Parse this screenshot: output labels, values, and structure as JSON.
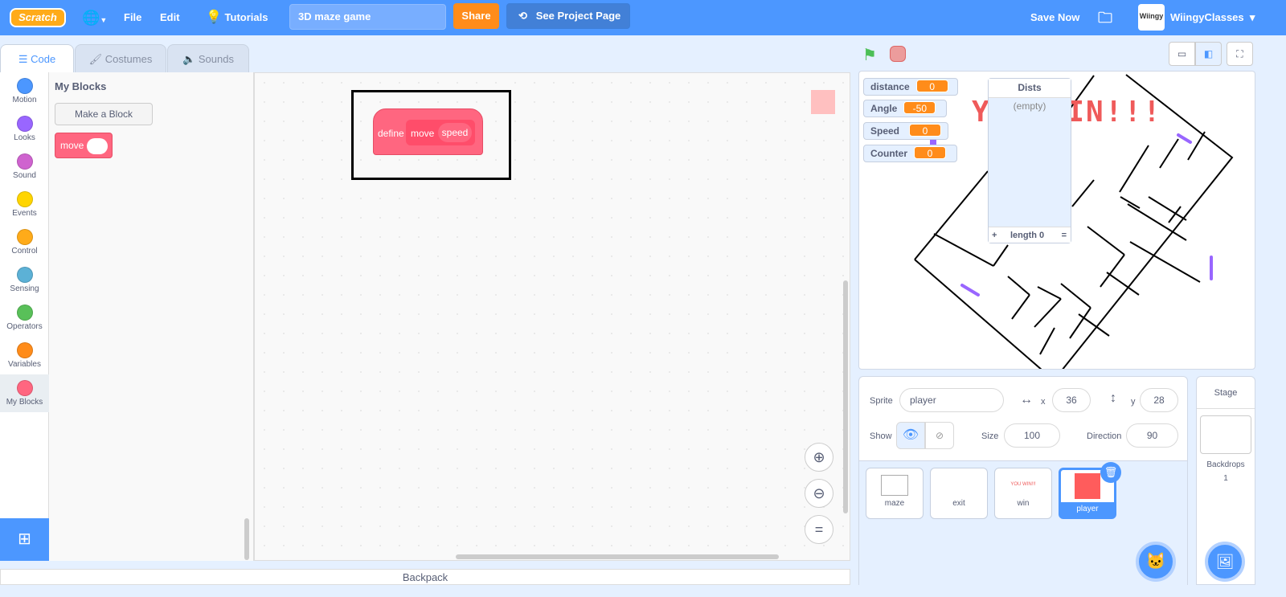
{
  "header": {
    "logo": "SCRATCH",
    "file": "File",
    "edit": "Edit",
    "tutorials": "Tutorials",
    "project_title": "3D maze game",
    "share": "Share",
    "see_project_page": "See Project Page",
    "save_now": "Save Now",
    "username": "WiingyClasses"
  },
  "tabs": [
    {
      "label": "Code"
    },
    {
      "label": "Costumes"
    },
    {
      "label": "Sounds"
    }
  ],
  "categories": [
    {
      "label": "Motion",
      "color": "#4c97ff"
    },
    {
      "label": "Looks",
      "color": "#9966ff"
    },
    {
      "label": "Sound",
      "color": "#cf63cf"
    },
    {
      "label": "Events",
      "color": "#ffd500"
    },
    {
      "label": "Control",
      "color": "#ffab19"
    },
    {
      "label": "Sensing",
      "color": "#5cb1d6"
    },
    {
      "label": "Operators",
      "color": "#59c059"
    },
    {
      "label": "Variables",
      "color": "#ff8c1a"
    },
    {
      "label": "My Blocks",
      "color": "#ff6680"
    }
  ],
  "palette": {
    "heading": "My Blocks",
    "make_block": "Make a Block",
    "block_label": "move"
  },
  "script": {
    "define": "define",
    "name": "move",
    "param": "speed"
  },
  "backpack": "Backpack",
  "monitors": [
    {
      "name": "distance",
      "value": "0"
    },
    {
      "name": "Angle",
      "value": "-50"
    },
    {
      "name": "Speed",
      "value": "0"
    },
    {
      "name": "Counter",
      "value": "0"
    }
  ],
  "list_monitor": {
    "title": "Dists",
    "empty": "(empty)",
    "add": "+",
    "length": "length 0",
    "resize": "="
  },
  "stage_text": "YOU WIN!!!",
  "sprite_info": {
    "sprite_label": "Sprite",
    "sprite_name": "player",
    "x_label": "x",
    "x": "36",
    "y_label": "y",
    "y": "28",
    "show_label": "Show",
    "size_label": "Size",
    "size": "100",
    "direction_label": "Direction",
    "direction": "90"
  },
  "sprites": [
    {
      "name": "maze"
    },
    {
      "name": "exit"
    },
    {
      "name": "win",
      "thumb_text": "YOU WIN!!!"
    },
    {
      "name": "player",
      "selected": true
    }
  ],
  "stage_panel": {
    "title": "Stage",
    "backdrops_label": "Backdrops",
    "backdrops_count": "1"
  },
  "colors": {
    "header": "#4c97ff",
    "accent_orange": "#ff8c1a",
    "myblocks": "#ff6680",
    "maze_marker": "#9966ff"
  }
}
